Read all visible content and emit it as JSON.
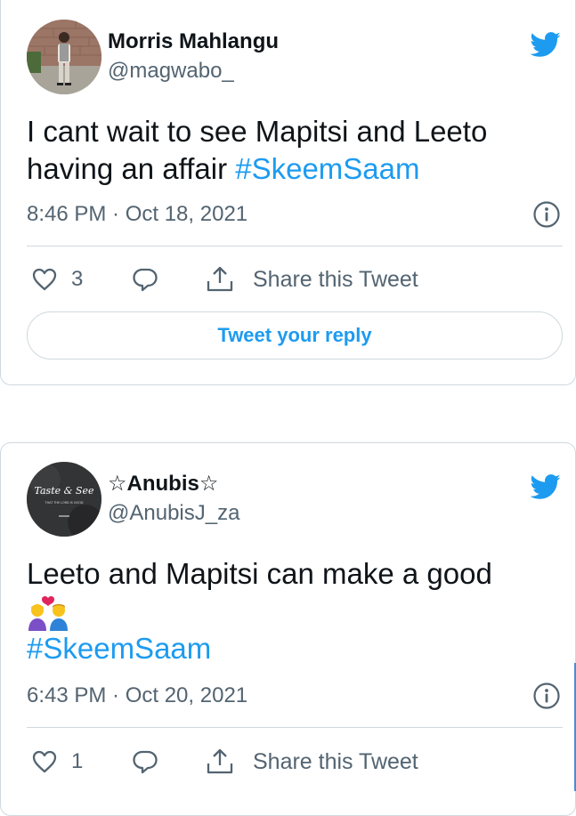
{
  "colors": {
    "accent": "#1d9bf0",
    "text": "#0f1419",
    "secondary": "#536471",
    "border": "#cfd9de"
  },
  "tweets": [
    {
      "author": {
        "name": "Morris Mahlangu",
        "handle": "@magwabo_",
        "avatar": "person-portrait"
      },
      "text_plain": "I cant wait to see Mapitsi and Leeto having an affair ",
      "hashtag": "#SkeemSaam",
      "timestamp": "8:46 PM · Oct 18, 2021",
      "likes": "3",
      "share_label": "Share this Tweet",
      "reply_label": "Tweet your reply",
      "icons": [
        "twitter-bird-icon",
        "info-icon",
        "heart-icon",
        "reply-bubble-icon",
        "share-icon"
      ]
    },
    {
      "author": {
        "name": "☆Anubis☆",
        "handle": "@AnubisJ_za",
        "avatar_caption": "Taste & See",
        "avatar_sub": "THAT THE LORD IS GOOD"
      },
      "text_plain": "Leeto and Mapitsi can make a good",
      "emoji": "couple-with-heart",
      "hashtag": "#SkeemSaam",
      "timestamp": "6:43 PM · Oct 20, 2021",
      "likes": "1",
      "share_label": "Share this Tweet",
      "icons": [
        "twitter-bird-icon",
        "info-icon",
        "heart-icon",
        "reply-bubble-icon",
        "share-icon"
      ]
    }
  ]
}
